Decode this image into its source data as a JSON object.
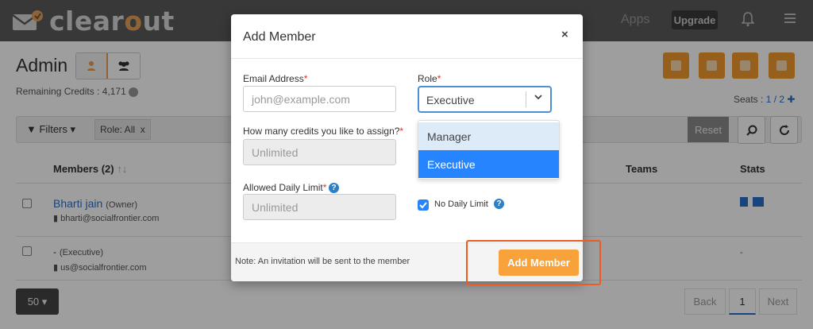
{
  "brand": {
    "name_a": "clear",
    "name_b": "o",
    "name_c": "ut"
  },
  "nav": {
    "apps": "Apps",
    "upgrade": "Upgrade"
  },
  "page": {
    "title": "Admin",
    "remaining_credits": "Remaining Credits : 4,171",
    "seats_label": "Seats : ",
    "seats_value": "1 / 2",
    "filters": "Filters",
    "role_filter": "Role: All",
    "role_filter_remove": "x",
    "reset": "Reset",
    "table": {
      "headers": {
        "members": "Members (2)",
        "teams": "Teams",
        "stats": "Stats"
      },
      "rows": [
        {
          "name": "Bharti jain",
          "role": "(Owner)",
          "email": "bharti@socialfrontier.com"
        },
        {
          "name": "-",
          "role": "(Executive)",
          "email": "us@socialfrontier.com",
          "stats": "-"
        }
      ]
    },
    "pagination": {
      "per_page": "50",
      "back": "Back",
      "page": "1",
      "next": "Next"
    }
  },
  "modal": {
    "title": "Add Member",
    "close": "×",
    "email": {
      "label": "Email Address",
      "required": "*",
      "placeholder": "john@example.com"
    },
    "role": {
      "label": "Role",
      "required": "*",
      "selected": "Executive",
      "options": [
        "Manager",
        "Executive"
      ]
    },
    "credits": {
      "label": "How many credits you like to assign?",
      "required": "*",
      "value": "Unlimited"
    },
    "daily": {
      "label": "Allowed Daily Limit",
      "required": "*",
      "value": "Unlimited"
    },
    "no_daily_limit": {
      "label": "No Daily Limit",
      "checked": true
    },
    "help": "?",
    "footer_note": "Note: An invitation will be sent to the member",
    "submit": "Add Member"
  },
  "colors": {
    "accent": "#f7a23a",
    "link": "#2a6fc9",
    "focus": "#2684ff",
    "highlight": "#ee5b1f"
  }
}
